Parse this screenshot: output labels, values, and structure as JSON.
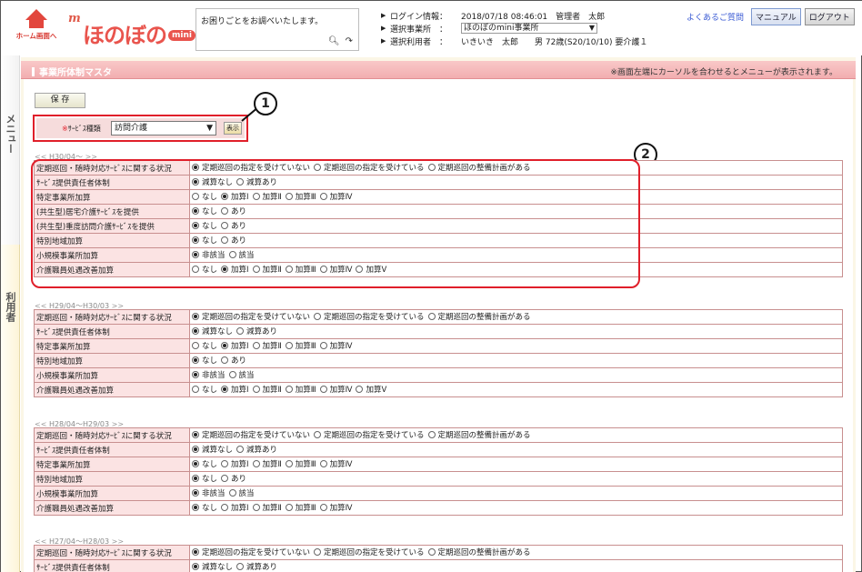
{
  "header": {
    "home_label": "ホーム画面へ",
    "logo_m": "m",
    "logo_text": "ほのぼの",
    "logo_mini": "mini",
    "help_text": "お困りごとをお調べいたします。",
    "login_label": "ログイン情報：",
    "login_value": "2018/07/18 08:46:01　管理者　太郎",
    "office_label": "選択事業所　：",
    "office_value": "ほのぼのmini事業所",
    "user_label": "選択利用者　：",
    "user_name": "いきいき　太郎",
    "user_detail": "男 72歳(S20/10/10) 要介護１",
    "faq": "よくあるご質問",
    "manual": "マニュアル",
    "logout": "ログアウト"
  },
  "side": {
    "menu": "メニュー",
    "user": "利用者"
  },
  "page": {
    "title": "事業所体制マスタ",
    "note": "※画面左端にカーソルを合わせるとメニューが表示されます。",
    "save": "保 存",
    "service_label_req": "※",
    "service_label": "ｻｰﾋﾞｽ種類",
    "service_value": "訪問介護",
    "show": "表示",
    "callout1": "1",
    "callout2": "2"
  },
  "periods": [
    {
      "label": "H30/04～",
      "prev": "<<",
      "next": ">>",
      "rows": [
        {
          "label": "定期巡回・随時対応ｻｰﾋﾞｽに関する状況",
          "options": [
            "定期巡回の指定を受けていない",
            "定期巡回の指定を受けている",
            "定期巡回の整備計画がある"
          ],
          "selected": 0
        },
        {
          "label": "ｻｰﾋﾞｽ提供責任者体制",
          "options": [
            "減算なし",
            "減算あり"
          ],
          "selected": 0
        },
        {
          "label": "特定事業所加算",
          "options": [
            "なし",
            "加算Ⅰ",
            "加算Ⅱ",
            "加算Ⅲ",
            "加算Ⅳ"
          ],
          "selected": 1
        },
        {
          "label": "(共生型)居宅介護ｻｰﾋﾞｽを提供",
          "options": [
            "なし",
            "あり"
          ],
          "selected": 0
        },
        {
          "label": "(共生型)重度訪問介護ｻｰﾋﾞｽを提供",
          "options": [
            "なし",
            "あり"
          ],
          "selected": 0
        },
        {
          "label": "特別地域加算",
          "options": [
            "なし",
            "あり"
          ],
          "selected": 0
        },
        {
          "label": "小規模事業所加算",
          "options": [
            "非該当",
            "該当"
          ],
          "selected": 0
        },
        {
          "label": "介護職員処遇改善加算",
          "options": [
            "なし",
            "加算Ⅰ",
            "加算Ⅱ",
            "加算Ⅲ",
            "加算Ⅳ",
            "加算Ⅴ"
          ],
          "selected": 1
        }
      ]
    },
    {
      "label": "H29/04～H30/03",
      "prev": "<<",
      "next": ">>",
      "rows": [
        {
          "label": "定期巡回・随時対応ｻｰﾋﾞｽに関する状況",
          "options": [
            "定期巡回の指定を受けていない",
            "定期巡回の指定を受けている",
            "定期巡回の整備計画がある"
          ],
          "selected": 0
        },
        {
          "label": "ｻｰﾋﾞｽ提供責任者体制",
          "options": [
            "減算なし",
            "減算あり"
          ],
          "selected": 0
        },
        {
          "label": "特定事業所加算",
          "options": [
            "なし",
            "加算Ⅰ",
            "加算Ⅱ",
            "加算Ⅲ",
            "加算Ⅳ"
          ],
          "selected": 1
        },
        {
          "label": "特別地域加算",
          "options": [
            "なし",
            "あり"
          ],
          "selected": 0
        },
        {
          "label": "小規模事業所加算",
          "options": [
            "非該当",
            "該当"
          ],
          "selected": 0
        },
        {
          "label": "介護職員処遇改善加算",
          "options": [
            "なし",
            "加算Ⅰ",
            "加算Ⅱ",
            "加算Ⅲ",
            "加算Ⅳ",
            "加算Ⅴ"
          ],
          "selected": 1
        }
      ]
    },
    {
      "label": "H28/04～H29/03",
      "prev": "<<",
      "next": ">>",
      "rows": [
        {
          "label": "定期巡回・随時対応ｻｰﾋﾞｽに関する状況",
          "options": [
            "定期巡回の指定を受けていない",
            "定期巡回の指定を受けている",
            "定期巡回の整備計画がある"
          ],
          "selected": 0
        },
        {
          "label": "ｻｰﾋﾞｽ提供責任者体制",
          "options": [
            "減算なし",
            "減算あり"
          ],
          "selected": 0
        },
        {
          "label": "特定事業所加算",
          "options": [
            "なし",
            "加算Ⅰ",
            "加算Ⅱ",
            "加算Ⅲ",
            "加算Ⅳ"
          ],
          "selected": 0
        },
        {
          "label": "特別地域加算",
          "options": [
            "なし",
            "あり"
          ],
          "selected": 0
        },
        {
          "label": "小規模事業所加算",
          "options": [
            "非該当",
            "該当"
          ],
          "selected": 0
        },
        {
          "label": "介護職員処遇改善加算",
          "options": [
            "なし",
            "加算Ⅰ",
            "加算Ⅱ",
            "加算Ⅲ",
            "加算Ⅳ"
          ],
          "selected": 0
        }
      ]
    },
    {
      "label": "H27/04～H28/03",
      "prev": "<<",
      "next": ">>",
      "rows": [
        {
          "label": "定期巡回・随時対応ｻｰﾋﾞｽに関する状況",
          "options": [
            "定期巡回の指定を受けていない",
            "定期巡回の指定を受けている",
            "定期巡回の整備計画がある"
          ],
          "selected": 0
        },
        {
          "label": "ｻｰﾋﾞｽ提供責任者体制",
          "options": [
            "減算なし",
            "減算あり"
          ],
          "selected": 0
        }
      ]
    }
  ]
}
